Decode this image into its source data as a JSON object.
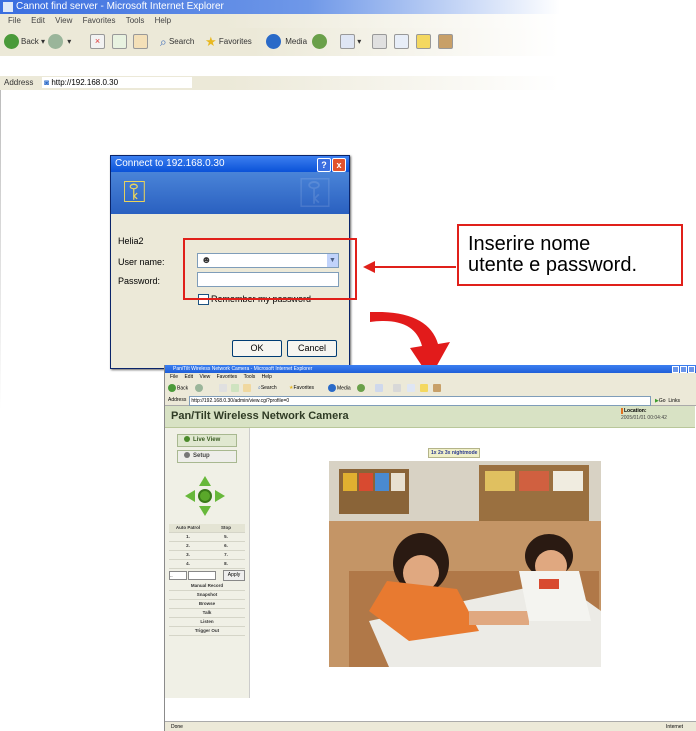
{
  "browser_bg": {
    "title": "Cannot find server - Microsoft Internet Explorer",
    "menu": [
      "File",
      "Edit",
      "View",
      "Favorites",
      "Tools",
      "Help"
    ],
    "toolbar": {
      "back": "Back",
      "search": "Search",
      "favorites": "Favorites",
      "media": "Media"
    },
    "address_label": "Address",
    "address_url": "http://192.168.0.30"
  },
  "login_dialog": {
    "title": "Connect to 192.168.0.30",
    "help_btn": "?",
    "close_btn": "x",
    "realm": "Helia2",
    "user_label": "User name:",
    "password_label": "Password:",
    "remember_label": "Remember my password",
    "ok_label": "OK",
    "cancel_label": "Cancel"
  },
  "callout": {
    "line1": "Inserire nome",
    "line2": "utente e password."
  },
  "camera_window": {
    "title": "Pan/Tilt Wireless Network Camera - Microsoft Internet Explorer",
    "menu": [
      "File",
      "Edit",
      "View",
      "Favorites",
      "Tools",
      "Help"
    ],
    "toolbar": {
      "back": "Back",
      "search": "Search",
      "favorites": "Favorites",
      "media": "Media"
    },
    "address_label": "Address",
    "address_url": "http://192.168.0.30/admin/view.cgi?profile=0",
    "go_label": "Go",
    "links_label": "Links",
    "header_title": "Pan/Tilt Wireless Network Camera",
    "location_label": "Location:",
    "datetime": "2005/01/01 00:04:42",
    "live_view": "Live View",
    "setup": "Setup",
    "patrol_header": [
      "Auto Patrol",
      "Stop"
    ],
    "presets": [
      [
        "1.",
        "5."
      ],
      [
        "2.",
        "6."
      ],
      [
        "3.",
        "7."
      ],
      [
        "4.",
        "8."
      ]
    ],
    "preset_select": "--",
    "apply": "Apply",
    "actions": [
      "Manual Record",
      "Snapshot",
      "Browse",
      "Talk",
      "Listen",
      "Trigger Out"
    ],
    "resolution_bar": "1x 2x 3x nightmode",
    "status_left": "Done",
    "status_right": "Internet"
  }
}
